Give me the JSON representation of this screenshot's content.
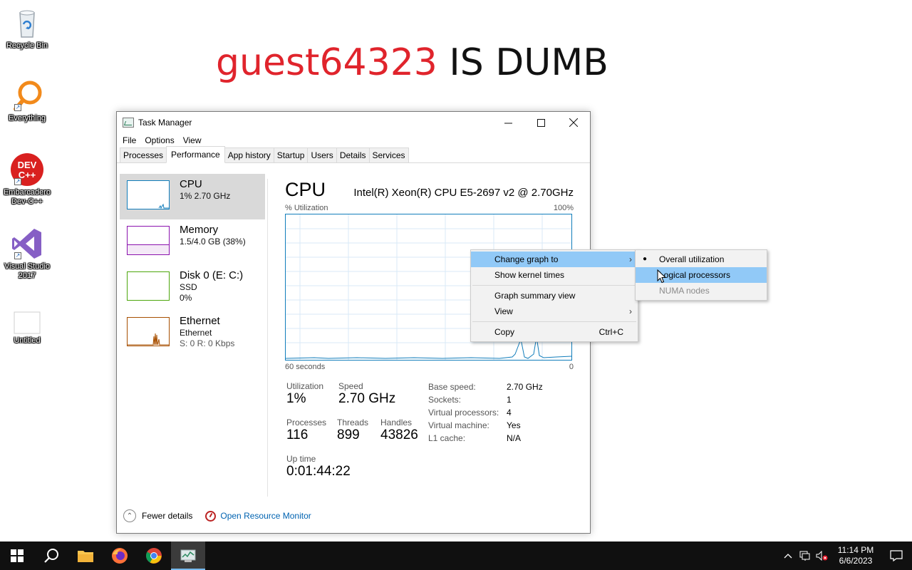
{
  "desktop": {
    "icons": [
      {
        "label": "Recycle Bin"
      },
      {
        "label": "Everything"
      },
      {
        "label": "Embarcadero Dev-C++",
        "badge": "DEV C++"
      },
      {
        "label": "Visual Studio 2017"
      },
      {
        "label": "Untitled"
      }
    ],
    "banner": {
      "red": "guest64323",
      "dark": " IS DUMB"
    }
  },
  "window": {
    "title": "Task Manager",
    "menu": [
      "File",
      "Options",
      "View"
    ],
    "tabs": [
      "Processes",
      "Performance",
      "App history",
      "Startup",
      "Users",
      "Details",
      "Services"
    ],
    "active_tab": "Performance",
    "sidebar": [
      {
        "title": "CPU",
        "sub1": "1% 2.70 GHz",
        "sub2": "",
        "color": "#117dbb"
      },
      {
        "title": "Memory",
        "sub1": "1.5/4.0 GB (38%)",
        "sub2": "",
        "color": "#8b12ae"
      },
      {
        "title": "Disk 0 (E: C:)",
        "sub1": "SSD",
        "sub2": "0%",
        "color": "#4da60c"
      },
      {
        "title": "Ethernet",
        "sub1": "Ethernet",
        "sub2": "S: 0 R: 0 Kbps",
        "color": "#a74f01"
      }
    ],
    "main": {
      "title": "CPU",
      "model": "Intel(R) Xeon(R) CPU E5-2697 v2 @ 2.70GHz",
      "graph_label_left": "% Utilization",
      "graph_label_right": "100%",
      "graph_bottom_left": "60 seconds",
      "graph_bottom_right": "0",
      "utilization_label": "Utilization",
      "utilization": "1%",
      "speed_label": "Speed",
      "speed": "2.70 GHz",
      "processes_label": "Processes",
      "processes": "116",
      "threads_label": "Threads",
      "threads": "899",
      "handles_label": "Handles",
      "handles": "43826",
      "uptime_label": "Up time",
      "uptime": "0:01:44:22",
      "specs": [
        {
          "k": "Base speed:",
          "v": "2.70 GHz"
        },
        {
          "k": "Sockets:",
          "v": "1"
        },
        {
          "k": "Virtual processors:",
          "v": "4"
        },
        {
          "k": "Virtual machine:",
          "v": "Yes"
        },
        {
          "k": "L1 cache:",
          "v": "N/A"
        }
      ]
    },
    "footer": {
      "fewer": "Fewer details",
      "resmon": "Open Resource Monitor"
    }
  },
  "context_menu": {
    "items": [
      {
        "label": "Change graph to",
        "submenu": true,
        "highlight": true
      },
      {
        "label": "Show kernel times"
      },
      {
        "label": "Graph summary view"
      },
      {
        "label": "View",
        "submenu": true
      },
      {
        "label": "Copy",
        "shortcut": "Ctrl+C"
      }
    ]
  },
  "submenu": {
    "items": [
      {
        "label": "Overall utilization",
        "checked": true
      },
      {
        "label": "Logical processors",
        "highlight": true
      },
      {
        "label": "NUMA nodes",
        "disabled": true
      }
    ]
  },
  "taskbar": {
    "time": "11:14 PM",
    "date": "6/6/2023"
  }
}
